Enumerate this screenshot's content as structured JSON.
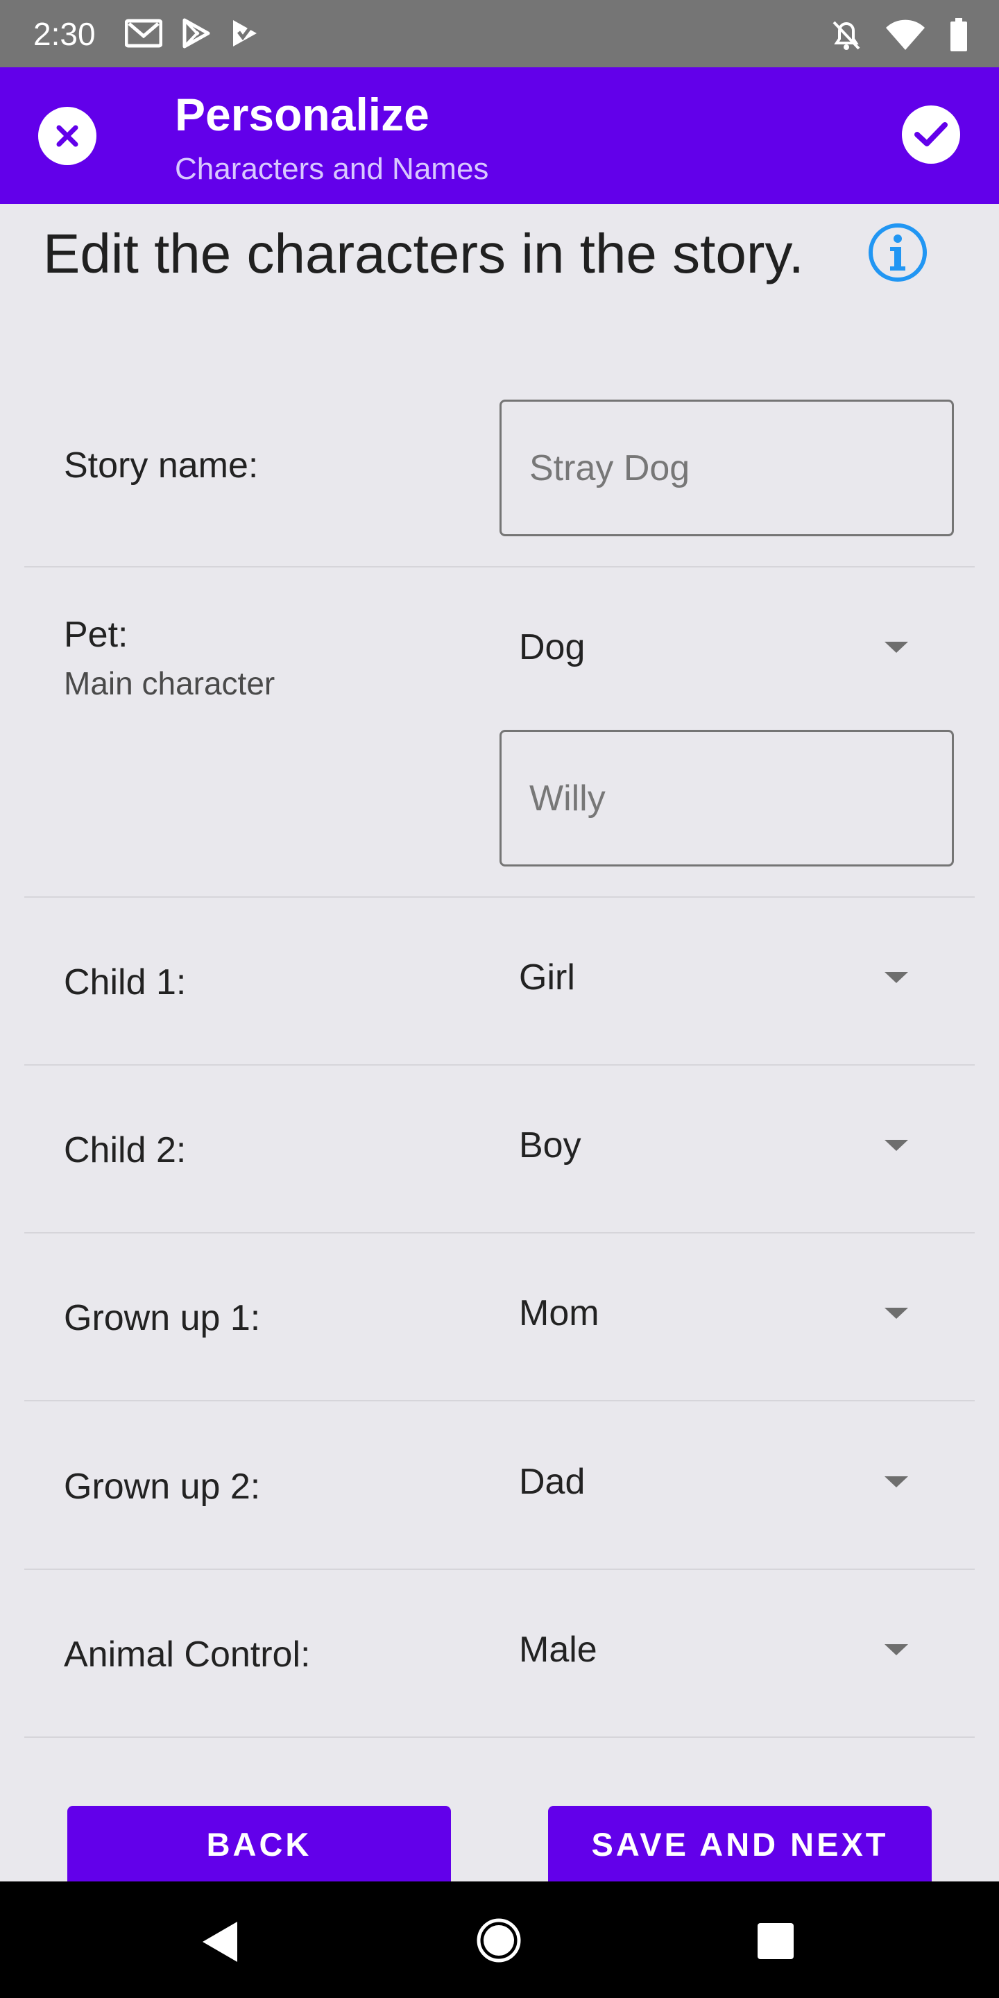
{
  "status_bar": {
    "time": "2:30",
    "icons_left": [
      "gmail-icon",
      "play-store-icon",
      "play-games-icon"
    ],
    "icons_right": [
      "notifications-off-icon",
      "wifi-icon",
      "battery-icon"
    ]
  },
  "app_bar": {
    "title": "Personalize",
    "subtitle": "Characters and Names",
    "color": "#6200ea"
  },
  "heading": "Edit the characters in the story.",
  "form": {
    "story_name": {
      "label": "Story name:",
      "value": "Stray Dog"
    },
    "pet": {
      "label": "Pet:",
      "sublabel": "Main character",
      "type": "Dog",
      "name": "Willy"
    },
    "child1": {
      "label": "Child 1:",
      "value": "Girl"
    },
    "child2": {
      "label": "Child 2:",
      "value": "Boy"
    },
    "grownup1": {
      "label": "Grown up 1:",
      "value": "Mom"
    },
    "grownup2": {
      "label": "Grown up 2:",
      "value": "Dad"
    },
    "animal_control": {
      "label": "Animal Control:",
      "value": "Male"
    }
  },
  "buttons": {
    "back": "BACK",
    "save_next": "SAVE AND NEXT"
  },
  "nav_bar": {
    "icons": [
      "back-triangle-icon",
      "home-circle-icon",
      "recents-square-icon"
    ]
  }
}
